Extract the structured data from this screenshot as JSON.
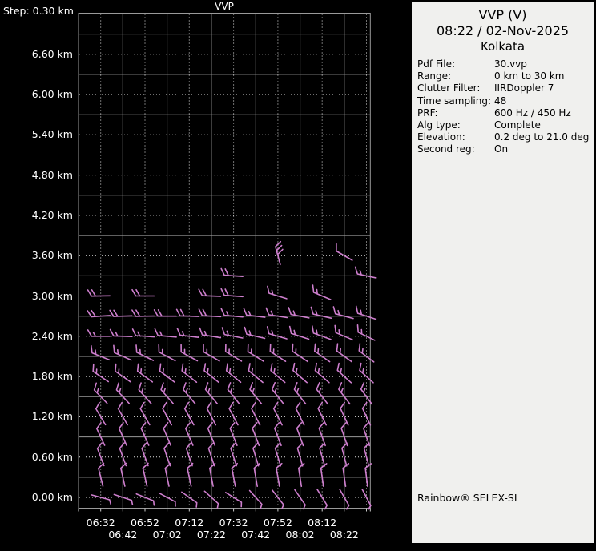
{
  "plot": {
    "title": "VVP",
    "step_label": "Step: 0.30 km"
  },
  "panel": {
    "title": "VVP (V)",
    "datetime": "08:22 / 02-Nov-2025",
    "location": "Kolkata",
    "fields": [
      {
        "label": "Pdf File:",
        "value": "30.vvp"
      },
      {
        "label": "Range:",
        "value": "0 km to 30 km"
      },
      {
        "label": "Clutter Filter:",
        "value": "IIRDoppler 7"
      },
      {
        "label": "Time sampling:",
        "value": "48"
      },
      {
        "label": "PRF:",
        "value": "600 Hz / 450 Hz"
      },
      {
        "label": "Alg type:",
        "value": "Complete"
      },
      {
        "label": "Elevation:",
        "value": "0.2 deg to 21.0 deg"
      },
      {
        "label": "Second reg:",
        "value": "On"
      }
    ],
    "branding": "Rainbow® SELEX-SI"
  },
  "chart_data": {
    "type": "wind-barb-time-height",
    "title": "VVP",
    "x_tick_labels": [
      "06:32",
      "06:42",
      "06:52",
      "07:02",
      "07:12",
      "07:22",
      "07:32",
      "07:42",
      "07:52",
      "08:02",
      "08:12",
      "08:22"
    ],
    "y_tick_labels": [
      "6.60 km",
      "6.00 km",
      "5.40 km",
      "4.80 km",
      "4.20 km",
      "3.60 km",
      "3.00 km",
      "2.40 km",
      "1.80 km",
      "1.20 km",
      "0.60 km",
      "0.00 km"
    ],
    "y_tick_values": [
      6.6,
      6.0,
      5.4,
      4.8,
      4.2,
      3.6,
      3.0,
      2.4,
      1.8,
      1.2,
      0.6,
      0.0
    ],
    "y_step_km": 0.3,
    "y_range_km": [
      -0.15,
      7.2
    ],
    "grid": {
      "solid_color": "#9a9a9a",
      "dotted_color": "#e0e0e0"
    },
    "colors": {
      "barb": "#ce7fce",
      "plot_bg": "#000000",
      "panel_bg": "#f0f0ee",
      "plot_text": "#ffffff"
    },
    "barb_units": {
      "full_tick_kt": 10,
      "half_tick_kt": 5
    },
    "barb_rows": [
      {
        "h": 3.6,
        "cols": [
          8,
          11
        ],
        "dirs": [
          105,
          150
        ],
        "ticks": [
          3,
          1
        ]
      },
      {
        "h": 3.3,
        "cols": [
          6,
          12
        ],
        "dirs": [
          176,
          168
        ],
        "ticks": [
          2,
          1.5
        ]
      },
      {
        "h": 3.0,
        "cols": [
          0,
          2,
          5,
          6,
          8,
          10
        ],
        "dirs": [
          181,
          180,
          178,
          176,
          163,
          157
        ],
        "ticks": [
          2,
          2,
          2,
          2,
          1.5,
          1.5
        ]
      },
      {
        "h": 2.7,
        "cols": [
          0,
          1,
          2,
          3,
          4,
          5,
          6,
          7,
          8,
          9,
          10,
          11,
          12
        ],
        "dirs": [
          184,
          182,
          181,
          180,
          178,
          177,
          175,
          173,
          171,
          169,
          167,
          165,
          162
        ],
        "ticks": [
          2,
          2,
          2,
          2,
          2,
          2,
          1.5,
          1.5,
          1.5,
          1.5,
          1.5,
          1.5,
          1.5
        ]
      },
      {
        "h": 2.4,
        "cols": [
          0,
          1,
          2,
          3,
          4,
          5,
          6,
          7,
          8,
          9,
          10,
          11,
          12
        ],
        "dirs": [
          180,
          178,
          176,
          175,
          173,
          171,
          169,
          167,
          164,
          162,
          160,
          157,
          154
        ],
        "ticks": [
          1.5,
          1.5,
          1.5,
          1.5,
          1.5,
          1.5,
          1.5,
          1.5,
          1.5,
          1.5,
          1.5,
          1.5,
          1.5
        ]
      },
      {
        "h": 2.1,
        "cols": [
          0,
          1,
          2,
          3,
          4,
          5,
          6,
          7,
          8,
          9,
          10,
          11,
          12
        ],
        "dirs": [
          158,
          156,
          154,
          152,
          151,
          150,
          149,
          148,
          147,
          146,
          145,
          144,
          143
        ],
        "ticks": [
          1.5,
          1.5,
          1.5,
          1.5,
          1.5,
          1.5,
          1.5,
          1.5,
          1.5,
          1.5,
          1.5,
          1.5,
          1.5
        ]
      },
      {
        "h": 1.8,
        "cols": [
          0,
          1,
          2,
          3,
          4,
          5,
          6,
          7,
          8,
          9,
          10,
          11,
          12
        ],
        "dirs": [
          146,
          145,
          144,
          143,
          142,
          141,
          141,
          140,
          140,
          139,
          139,
          138,
          138
        ],
        "ticks": [
          1.5,
          1.5,
          1.5,
          1.5,
          1.5,
          1.5,
          1.5,
          1.5,
          1.5,
          1.5,
          1.5,
          1.5,
          1.5
        ]
      },
      {
        "h": 1.5,
        "cols": [
          0,
          1,
          2,
          3,
          4,
          5,
          6,
          7,
          8,
          9,
          10,
          11,
          12
        ],
        "dirs": [
          134,
          133,
          132,
          131,
          130,
          130,
          129,
          129,
          128,
          128,
          127,
          127,
          126
        ],
        "ticks": [
          1.5,
          1.5,
          1.5,
          1.5,
          1.5,
          1.5,
          1.5,
          1.5,
          1.5,
          1.5,
          1.5,
          1.5,
          1.5
        ]
      },
      {
        "h": 1.2,
        "cols": [
          0,
          1,
          2,
          3,
          4,
          5,
          6,
          7,
          8,
          9,
          10,
          11,
          12
        ],
        "dirs": [
          121,
          120,
          120,
          119,
          119,
          118,
          118,
          117,
          117,
          116,
          116,
          115,
          115
        ],
        "ticks": [
          1,
          1,
          1,
          1,
          1,
          1,
          1,
          1,
          1,
          1,
          1,
          1,
          1
        ]
      },
      {
        "h": 0.9,
        "cols": [
          0,
          1,
          2,
          3,
          4,
          5,
          6,
          7,
          8,
          9,
          10,
          11,
          12
        ],
        "dirs": [
          115,
          114,
          114,
          113,
          113,
          112,
          112,
          111,
          111,
          110,
          110,
          109,
          109
        ],
        "ticks": [
          1,
          1,
          1,
          1,
          1,
          1,
          1,
          1,
          1,
          1,
          1,
          1,
          1
        ]
      },
      {
        "h": 0.6,
        "cols": [
          0,
          1,
          2,
          3,
          4,
          5,
          6,
          7,
          8,
          9,
          10,
          11,
          12
        ],
        "dirs": [
          111,
          110,
          110,
          109,
          109,
          108,
          108,
          107,
          107,
          106,
          106,
          105,
          105
        ],
        "ticks": [
          1,
          1,
          1,
          1,
          1,
          1,
          1,
          1,
          1,
          1,
          1,
          1,
          1
        ]
      },
      {
        "h": 0.3,
        "cols": [
          0,
          1,
          2,
          3,
          4,
          5,
          6,
          7,
          8,
          9,
          10,
          11,
          12
        ],
        "dirs": [
          104,
          103,
          103,
          102,
          102,
          101,
          101,
          100,
          100,
          99,
          98,
          98,
          97
        ],
        "ticks": [
          1,
          1,
          1,
          1,
          1,
          1,
          1,
          1,
          1,
          1,
          1,
          1,
          1
        ]
      },
      {
        "h": 0.0,
        "cols": [
          0,
          1,
          2,
          3,
          4,
          5,
          6,
          7,
          8,
          9,
          10,
          11,
          12
        ],
        "dirs": [
          -15,
          -18,
          -22,
          -28,
          -35,
          -42,
          -32,
          -48,
          -52,
          -55,
          -58,
          -60,
          -62
        ],
        "ticks": [
          0.5,
          0.5,
          0.5,
          0.5,
          0.5,
          0.5,
          0.5,
          0.5,
          0.5,
          0.5,
          0.5,
          0.5,
          0.5
        ]
      }
    ]
  }
}
